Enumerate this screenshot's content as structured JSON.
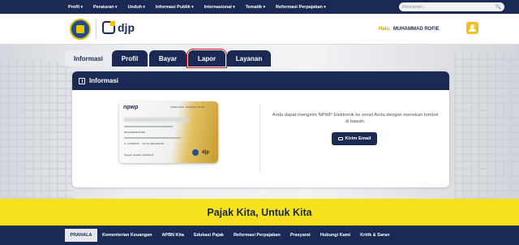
{
  "topnav": {
    "menu": [
      "Profil",
      "Peraturan",
      "Unduh",
      "Informasi Publik",
      "Internasional",
      "Tematik",
      "Reformasi Perpajakan"
    ],
    "search_placeholder": "Pencarian..."
  },
  "header": {
    "logo_text": "djp",
    "greeting": "Halo,",
    "user_name": "MUHAMMAD ROFIE"
  },
  "tabs": [
    "Informasi",
    "Profil",
    "Bayar",
    "Lapor",
    "Layanan"
  ],
  "card": {
    "title": "Informasi",
    "npwp_label": "npwp",
    "npwp_header": "DIREKTORAT JENDERAL PAJAK",
    "npwp_holder": "MUHAMMAD ROFIE",
    "npwp_address": "JL. KAMPUNG ... NO.12, KELURAHAN ...",
    "npwp_registered": "Tanggal Terdaftar 12/02/2016",
    "npwp_logo": "djp",
    "message": "Anda dapat mengirim NPWP Elektronik ke email Anda dengan menekan tombol di bawah.",
    "send_button": "Kirim Email"
  },
  "banner": "Pajak Kita, Untuk Kita",
  "footnav": {
    "active": "PRANALA",
    "links": [
      "Kementerian Keuangan",
      "APBN Kita",
      "Edukasi Pajak",
      "Reformasi Perpajakan",
      "Prasyarat",
      "Hubungi Kami",
      "Kritik & Saran"
    ]
  },
  "colors": {
    "navy": "#1b2a55",
    "yellow": "#f7e11f",
    "highlight_red": "#dd1111"
  }
}
